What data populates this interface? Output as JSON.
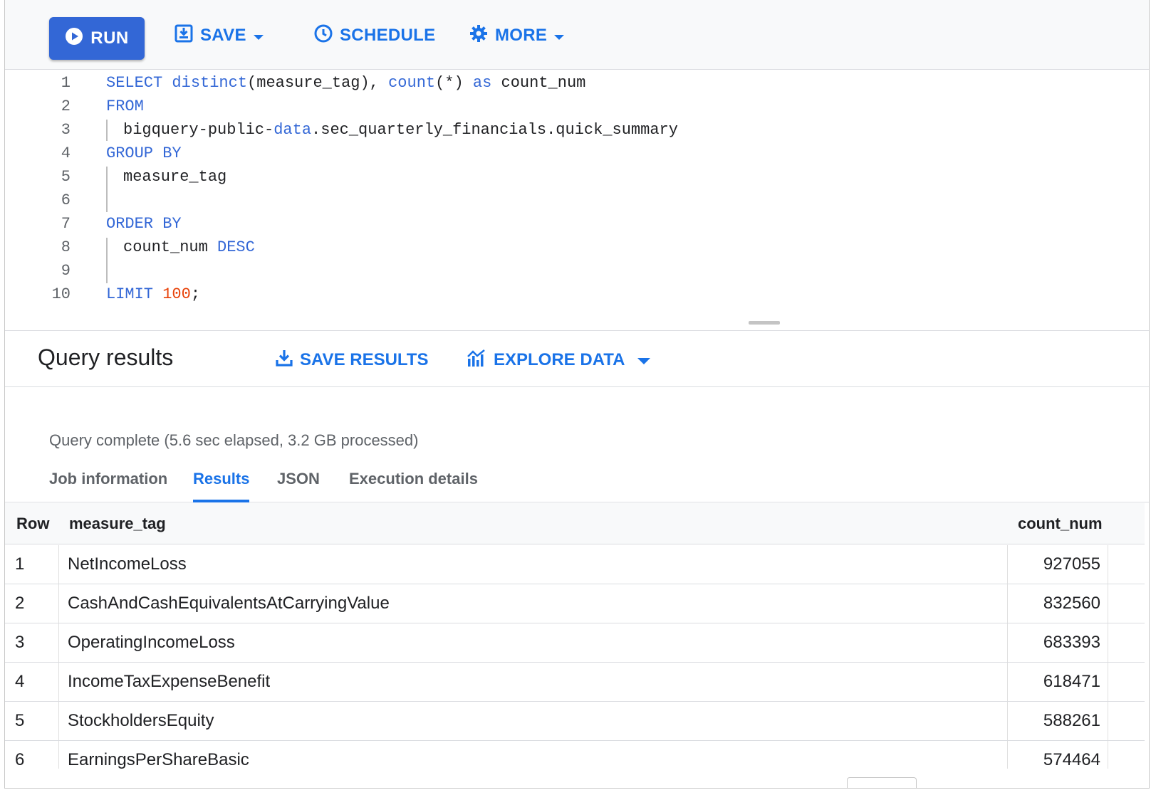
{
  "toolbar": {
    "run_label": "RUN",
    "save_label": "SAVE",
    "schedule_label": "SCHEDULE",
    "more_label": "MORE"
  },
  "editor": {
    "lines": [
      {
        "n": "1"
      },
      {
        "n": "2"
      },
      {
        "n": "3"
      },
      {
        "n": "4"
      },
      {
        "n": "5"
      },
      {
        "n": "6"
      },
      {
        "n": "7"
      },
      {
        "n": "8"
      },
      {
        "n": "9"
      },
      {
        "n": "10"
      }
    ],
    "tokens": {
      "select": "SELECT",
      "distinct": "distinct",
      "distinct_arg": "(measure_tag), ",
      "count": "count",
      "count_arg": "(*) ",
      "as": "as",
      "alias": " count_num",
      "from": "FROM",
      "table_a": "bigquery-public-",
      "table_b": "data",
      "table_c": ".sec_quarterly_financials.quick_summary",
      "group_by": "GROUP BY",
      "group_col": "measure_tag",
      "order_by": "ORDER BY",
      "order_col": "count_num ",
      "desc": "DESC",
      "limit": "LIMIT",
      "limit_val": "100",
      "semicolon": ";"
    }
  },
  "results": {
    "title": "Query results",
    "save_results_label": "SAVE RESULTS",
    "explore_data_label": "EXPLORE DATA",
    "status": "Query complete (5.6 sec elapsed, 3.2 GB processed)",
    "tabs": [
      "Job information",
      "Results",
      "JSON",
      "Execution details"
    ],
    "active_tab": "Results",
    "columns": [
      "Row",
      "measure_tag",
      "count_num"
    ],
    "rows": [
      {
        "row": "1",
        "measure_tag": "NetIncomeLoss",
        "count_num": "927055"
      },
      {
        "row": "2",
        "measure_tag": "CashAndCashEquivalentsAtCarryingValue",
        "count_num": "832560"
      },
      {
        "row": "3",
        "measure_tag": "OperatingIncomeLoss",
        "count_num": "683393"
      },
      {
        "row": "4",
        "measure_tag": "IncomeTaxExpenseBenefit",
        "count_num": "618471"
      },
      {
        "row": "5",
        "measure_tag": "StockholdersEquity",
        "count_num": "588261"
      },
      {
        "row": "6",
        "measure_tag": "EarningsPerShareBasic",
        "count_num": "574464"
      }
    ]
  },
  "colors": {
    "accent": "#1a73e8",
    "run_button": "#3367d6",
    "keyword": "#3367d6",
    "number": "#e8430a"
  },
  "icons": {
    "run": "play-circle-icon",
    "save": "save-icon",
    "schedule": "clock-icon",
    "more": "gear-icon",
    "save_results": "download-icon",
    "explore_data": "chart-icon",
    "dropdown": "caret-down-icon"
  }
}
